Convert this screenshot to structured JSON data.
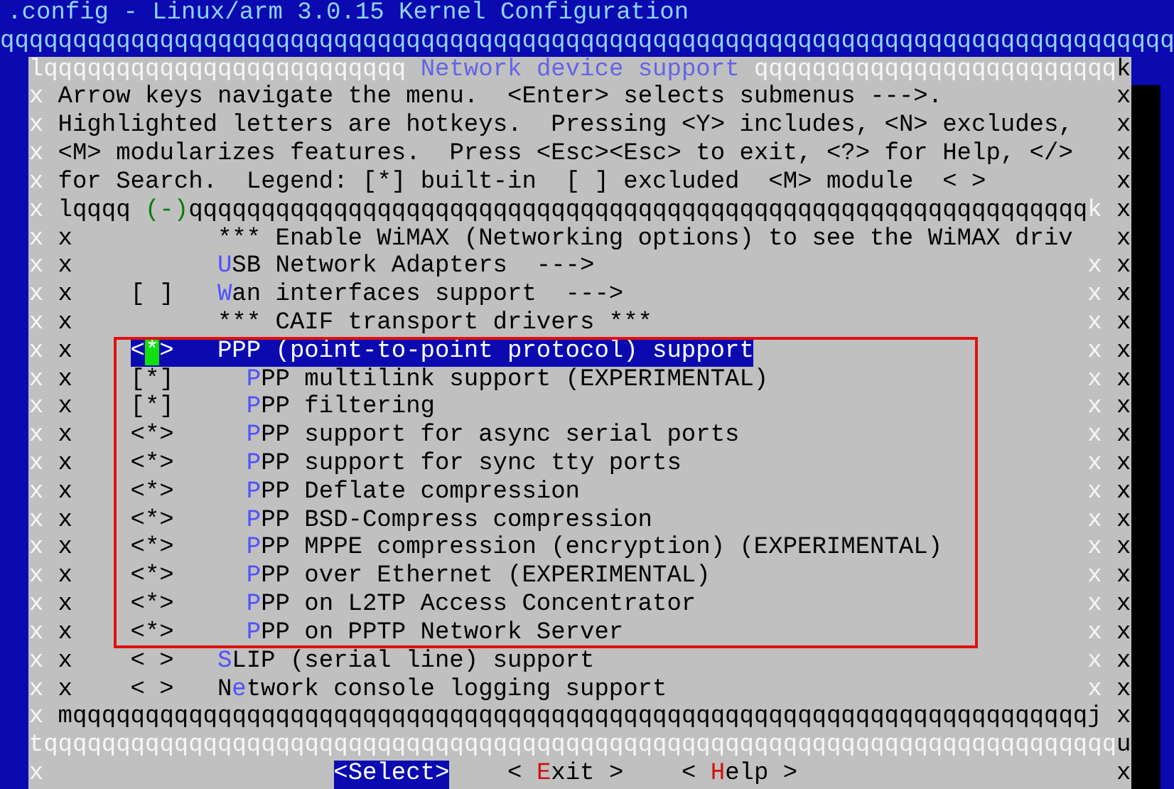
{
  "window": {
    "title": ".config - Linux/arm 3.0.15 Kernel Configuration"
  },
  "top_rule": "qqqqqqqqqqqqqqqqqqqqqqqqqqqqqqqqqqqqqqqqqqqqqqqqqqqqqqqqqqqqqqqqqqqqqqqqqqqqqqqqq",
  "dialog": {
    "top_left": "lqqqqqqqqqqqqqqqqqqqqqqqqq",
    "title": "Network device support",
    "top_right": "qqqqqqqqqqqqqqqqqqqqqqqqq",
    "top_corner": "k",
    "help_lines": [
      {
        "edge_left": "x",
        "text": "Arrow keys navigate the menu.  <Enter> selects submenus --->.",
        "edge_right": "x"
      },
      {
        "edge_left": "x",
        "text": "Highlighted letters are hotkeys.  Pressing <Y> includes, <N> excludes,",
        "edge_right": "x"
      },
      {
        "edge_left": "x",
        "text": "<M> modularizes features.  Press <Esc><Esc> to exit, <?> for Help, </>",
        "edge_right": "x"
      },
      {
        "edge_left": "x",
        "text": "for Search.  Legend: [*] built-in  [ ] excluded  <M> module  < >",
        "edge_right": "x"
      }
    ],
    "menu": {
      "edge_left": "x",
      "top_left": "lqqqq",
      "scroll_indicator": "(-)",
      "top_rule": "qqqqqqqqqqqqqqqqqqqqqqqqqqqqqqqqqqqqqqqqqqqqqqqqqqqqqqqqqqqqqq",
      "top_corner": "k",
      "edge_right": "x",
      "items": [
        {
          "edge_left": "x",
          "inner_left": "x",
          "label": "*** Enable WiMAX (Networking options) to see the WiMAX driv",
          "selected": false,
          "annotated": false,
          "edge_right": "x"
        },
        {
          "edge_left": "x",
          "inner_left": "x",
          "hotkey": "U",
          "label": "SB Network Adapters  --->",
          "selected": false,
          "annotated": false,
          "inner_right": "x",
          "edge_right": "x"
        },
        {
          "edge_left": "x",
          "inner_left": "x",
          "prompt": "[ ]",
          "hotkey": "W",
          "label": "an interfaces support  --->",
          "selected": false,
          "annotated": false,
          "inner_right": "x",
          "edge_right": "x"
        },
        {
          "edge_left": "x",
          "inner_left": "x",
          "label": "*** CAIF transport drivers ***",
          "selected": false,
          "annotated": false,
          "inner_right": "x",
          "edge_right": "x"
        },
        {
          "edge_left": "x",
          "inner_left": "x",
          "prompt": "<*>",
          "hotkey": "P",
          "label": "PP (point-to-point protocol) support",
          "selected": true,
          "annotated": true,
          "inner_right": "x",
          "edge_right": "x",
          "children": [
            {
              "edge_left": "x",
              "inner_left": "x",
              "prompt": "[*]",
              "hotkey": "P",
              "label": "PP multilink support (EXPERIMENTAL)",
              "selected": false,
              "inner_right": "x",
              "edge_right": "x"
            },
            {
              "edge_left": "x",
              "inner_left": "x",
              "prompt": "[*]",
              "hotkey": "P",
              "label": "PP filtering",
              "selected": false,
              "inner_right": "x",
              "edge_right": "x"
            },
            {
              "edge_left": "x",
              "inner_left": "x",
              "prompt": "<*>",
              "hotkey": "P",
              "label": "PP support for async serial ports",
              "selected": false,
              "inner_right": "x",
              "edge_right": "x"
            },
            {
              "edge_left": "x",
              "inner_left": "x",
              "prompt": "<*>",
              "hotkey": "P",
              "label": "PP support for sync tty ports",
              "selected": false,
              "inner_right": "x",
              "edge_right": "x"
            },
            {
              "edge_left": "x",
              "inner_left": "x",
              "prompt": "<*>",
              "hotkey": "P",
              "label": "PP Deflate compression",
              "selected": false,
              "inner_right": "x",
              "edge_right": "x"
            },
            {
              "edge_left": "x",
              "inner_left": "x",
              "prompt": "<*>",
              "hotkey": "P",
              "label": "PP BSD-Compress compression",
              "selected": false,
              "inner_right": "x",
              "edge_right": "x"
            },
            {
              "edge_left": "x",
              "inner_left": "x",
              "prompt": "<*>",
              "hotkey": "P",
              "label": "PP MPPE compression (encryption) (EXPERIMENTAL)",
              "selected": false,
              "inner_right": "x",
              "edge_right": "x"
            },
            {
              "edge_left": "x",
              "inner_left": "x",
              "prompt": "<*>",
              "hotkey": "P",
              "label": "PP over Ethernet (EXPERIMENTAL)",
              "selected": false,
              "inner_right": "x",
              "edge_right": "x"
            },
            {
              "edge_left": "x",
              "inner_left": "x",
              "prompt": "<*>",
              "hotkey": "P",
              "label": "PP on L2TP Access Concentrator",
              "selected": false,
              "inner_right": "x",
              "edge_right": "x"
            },
            {
              "edge_left": "x",
              "inner_left": "x",
              "prompt": "<*>",
              "hotkey": "P",
              "label": "PP on PPTP Network Server",
              "selected": false,
              "inner_right": "x",
              "edge_right": "x"
            }
          ]
        },
        {
          "edge_left": "x",
          "inner_left": "x",
          "prompt": "< >",
          "hotkey": "S",
          "label": "LIP (serial line) support",
          "selected": false,
          "annotated": false,
          "inner_right": "x",
          "edge_right": "x"
        },
        {
          "edge_left": "x",
          "inner_left": "x",
          "prompt": "< >",
          "lead": "N",
          "hotkey": "e",
          "label": "twork console logging support",
          "selected": false,
          "annotated": false,
          "inner_right": "x",
          "edge_right": "x"
        }
      ],
      "bottom": {
        "edge_left": "x",
        "rule": "mqqqqqqqqqqqqqqqqqqqqqqqqqqqqqqqqqqqqqqqqqqqqqqqqqqqqqqqqqqqqqqqqqqqqqqj",
        "edge_right": "x"
      }
    },
    "separator": "tqqqqqqqqqqqqqqqqqqqqqqqqqqqqqqqqqqqqqqqqqqqqqqqqqqqqqqqqqqqqqqqqqqqqqqqqqq",
    "separator_end": "u",
    "button_row": {
      "edge_left": "x",
      "buttons": [
        {
          "before": "<",
          "hotkey": "S",
          "after": "elect>",
          "selected": true
        },
        {
          "before": "< ",
          "hotkey": "E",
          "after": "xit >",
          "selected": false
        },
        {
          "before": "< ",
          "hotkey": "H",
          "after": "elp >",
          "selected": false
        }
      ],
      "edge_right": "x"
    }
  }
}
